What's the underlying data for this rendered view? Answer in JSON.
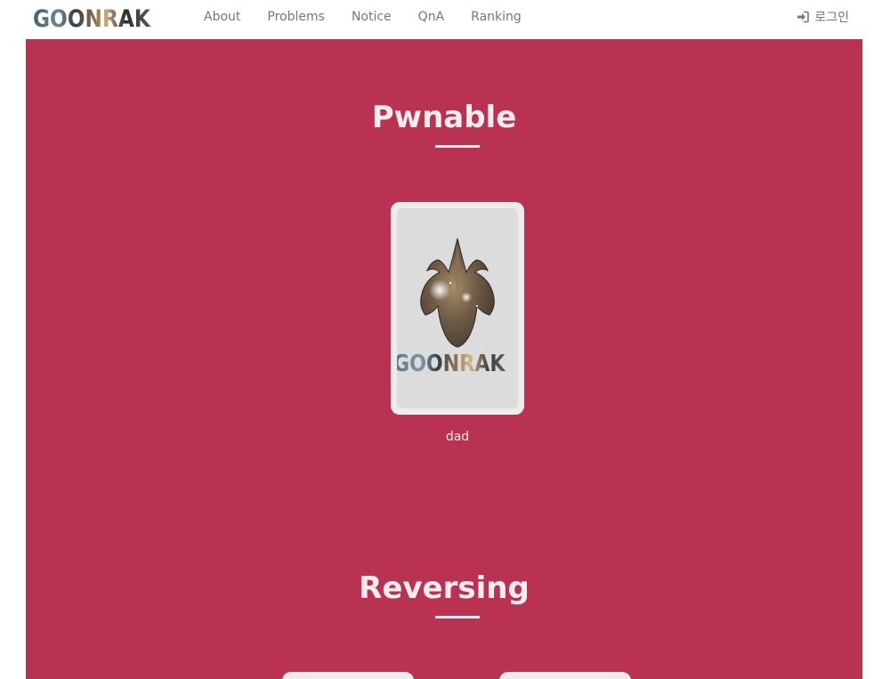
{
  "navbar": {
    "brand": "GOONRAK",
    "links": [
      "About",
      "Problems",
      "Notice",
      "QnA",
      "Ranking"
    ],
    "login_label": "로그인",
    "login_icon": "sign-in-icon"
  },
  "colors": {
    "accent_background": "#b93252",
    "card_background": "#ececec",
    "heading_text": "#fbecef",
    "nav_text": "#777777"
  },
  "sections": [
    {
      "title": "Pwnable",
      "problems": [
        {
          "name": "dad",
          "image": "goonrak-emblem-icon",
          "image_text": "GOONRAK"
        }
      ]
    },
    {
      "title": "Reversing",
      "problems": []
    }
  ]
}
